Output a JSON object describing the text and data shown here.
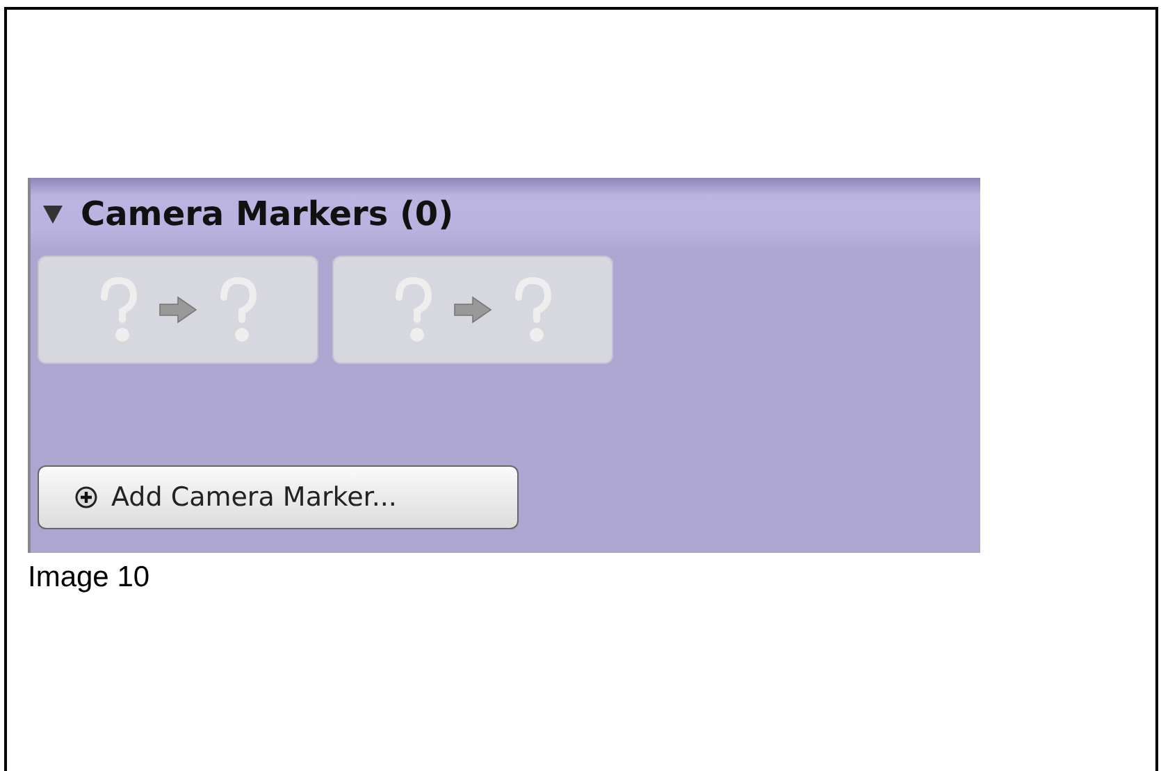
{
  "panel": {
    "title": "Camera Markers (0)",
    "expanded": true,
    "marker_slots": [
      {
        "kind": "empty"
      },
      {
        "kind": "empty"
      }
    ],
    "add_button": "Add Camera Marker..."
  },
  "caption": "Image 10"
}
